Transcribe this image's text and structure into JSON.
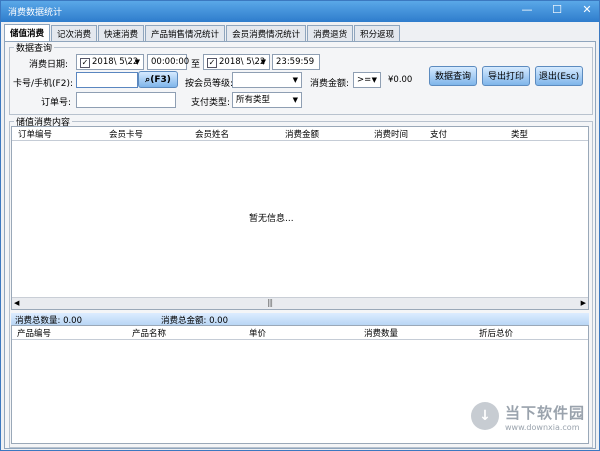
{
  "window": {
    "title": "消费数据统计",
    "min": "—",
    "max": "☐",
    "close": "✕"
  },
  "tabs": [
    "储值消费",
    "记次消费",
    "快速消费",
    "产品销售情况统计",
    "会员消费情况统计",
    "消费退货",
    "积分返现"
  ],
  "query": {
    "legend": "数据查询",
    "date_label": "消费日期:",
    "date_from": "2018\\ 5\\22",
    "time_from": "00:00:00",
    "to_label": "至",
    "date_to": "2018\\ 5\\22",
    "time_to": "23:59:59",
    "card_label": "卡号/手机(F2):",
    "card_value": "",
    "f3_label": "(F3)",
    "level_label": "按会员等级:",
    "level_value": "",
    "amount_label": "消费金额:",
    "op_value": ">=",
    "amount_value": "¥0.00",
    "order_label": "订单号:",
    "order_value": "",
    "paytype_label": "支付类型:",
    "paytype_value": "所有类型",
    "btn_query": "数据查询",
    "btn_export": "导出打印",
    "btn_exit": "退出(Esc)"
  },
  "content": {
    "legend": "储值消费内容",
    "columns": [
      "订单编号",
      "会员卡号",
      "会员姓名",
      "消费金额",
      "消费时间",
      "支付",
      "类型"
    ],
    "empty_text": "暂无信息..."
  },
  "summary": {
    "count_label": "消费总数量: 0.00",
    "amount_label": "消费总金额:  0.00"
  },
  "detail": {
    "columns": [
      "产品编号",
      "产品名称",
      "单价",
      "消费数量",
      "折后总价"
    ]
  },
  "watermark": {
    "logo": "↓",
    "name": "当下软件园",
    "url": "www.downxia.com"
  }
}
